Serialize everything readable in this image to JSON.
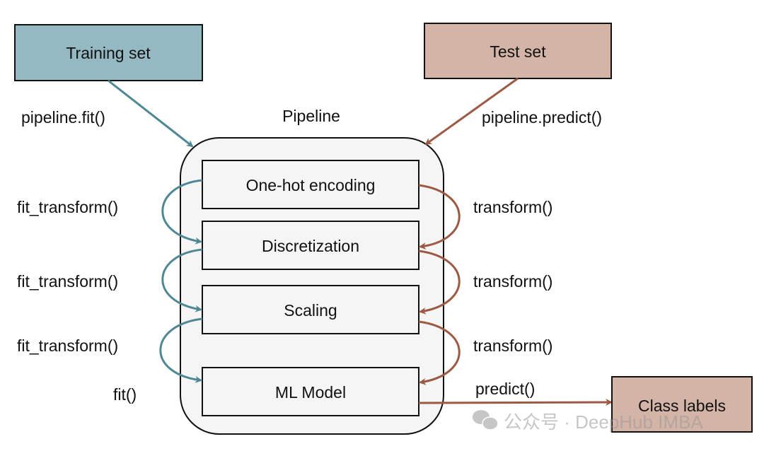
{
  "colors": {
    "training_fill": "#94b9c2",
    "test_fill": "#d5b4a8",
    "fit_path": "#4e8894",
    "predict_path": "#9c5a44",
    "pipeline_fill": "#f5f5f5"
  },
  "inputs": {
    "training": "Training set",
    "test": "Test set"
  },
  "pipeline": {
    "title": "Pipeline",
    "steps": [
      "One-hot encoding",
      "Discretization",
      "Scaling",
      "ML Model"
    ]
  },
  "output": "Class labels",
  "left_labels": {
    "entry": "pipeline.fit()",
    "steps": [
      "fit_transform()",
      "fit_transform()",
      "fit_transform()",
      "fit()"
    ]
  },
  "right_labels": {
    "entry": "pipeline.predict()",
    "steps": [
      "transform()",
      "transform()",
      "transform()"
    ],
    "final": "predict()"
  },
  "watermark": "公众号 · DeepHub IMBA"
}
